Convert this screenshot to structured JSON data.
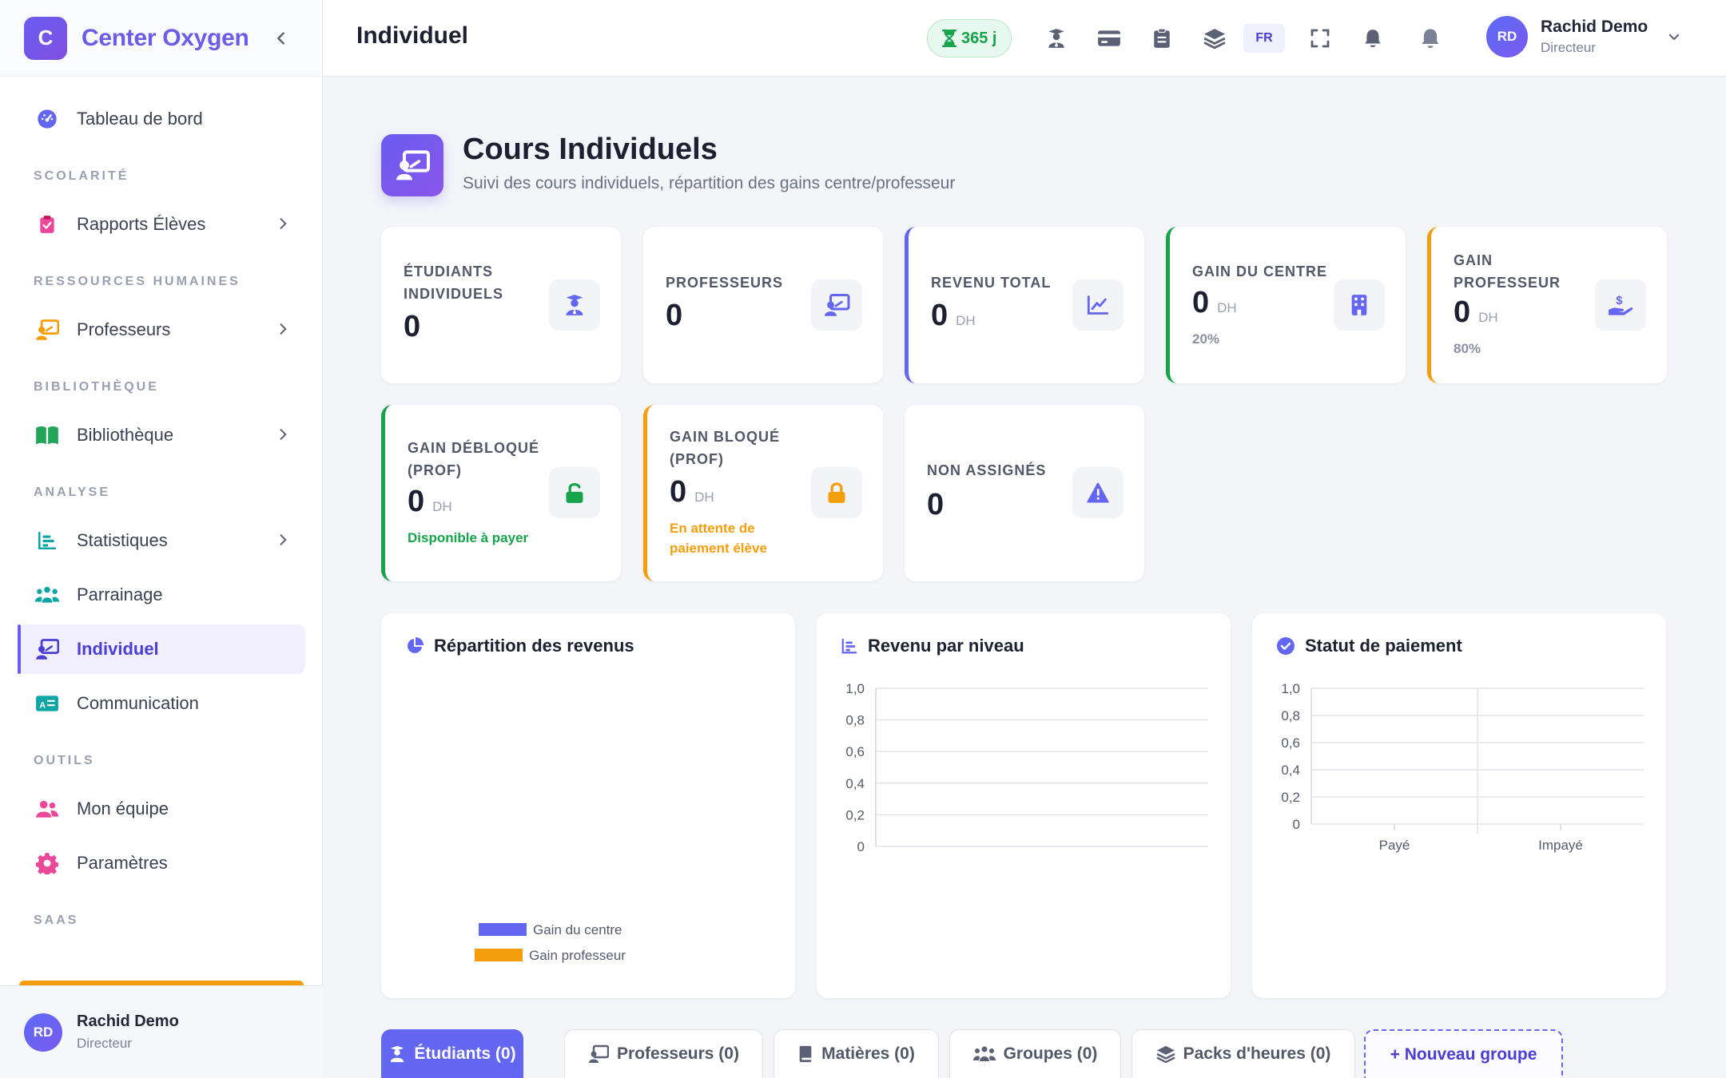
{
  "app": {
    "brand_letter": "C",
    "brand_name": "Center Oxygen"
  },
  "sidebar": {
    "dashboard": "Tableau de bord",
    "sec_scolarite": "SCOLARITÉ",
    "rapports": "Rapports Élèves",
    "sec_rh": "RESSOURCES HUMAINES",
    "professeurs": "Professeurs",
    "sec_biblio": "BIBLIOTHÈQUE",
    "bibliotheque": "Bibliothèque",
    "sec_analyse": "ANALYSE",
    "statistiques": "Statistiques",
    "parrainage": "Parrainage",
    "individuel": "Individuel",
    "communication": "Communication",
    "sec_outils": "OUTILS",
    "equipe": "Mon équipe",
    "parametres": "Paramètres",
    "sec_saas": "SAAS"
  },
  "user": {
    "initials": "RD",
    "name": "Rachid Demo",
    "role": "Directeur"
  },
  "topbar": {
    "title": "Individuel",
    "days": "365 j",
    "lang": "FR"
  },
  "header": {
    "title": "Cours Individuels",
    "subtitle": "Suivi des cours individuels, répartition des gains centre/professeur"
  },
  "stats": {
    "etudiants": {
      "label": "ÉTUDIANTS INDIVIDUELS",
      "value": "0"
    },
    "professeurs": {
      "label": "PROFESSEURS",
      "value": "0"
    },
    "revenu": {
      "label": "REVENU TOTAL",
      "value": "0",
      "unit": "DH"
    },
    "gain_centre": {
      "label": "GAIN DU CENTRE",
      "value": "0",
      "unit": "DH",
      "note": "20%"
    },
    "gain_prof": {
      "label": "GAIN PROFESSEUR",
      "value": "0",
      "unit": "DH",
      "note": "80%"
    },
    "debloque": {
      "label": "GAIN DÉBLOQUÉ (PROF)",
      "value": "0",
      "unit": "DH",
      "note": "Disponible à payer"
    },
    "bloque": {
      "label": "GAIN BLOQUÉ (PROF)",
      "value": "0",
      "unit": "DH",
      "note": "En attente de paiement élève"
    },
    "non_assignes": {
      "label": "NON ASSIGNÉS",
      "value": "0"
    }
  },
  "charts": {
    "repartition_title": "Répartition des revenus",
    "niveau_title": "Revenu par niveau",
    "statut_title": "Statut de paiement"
  },
  "colors": {
    "accent": "#6366f1",
    "success": "#16a34a",
    "warning": "#f59e0b"
  },
  "chart_data": [
    {
      "type": "pie",
      "title": "Répartition des revenus",
      "categories": [
        "Gain du centre",
        "Gain professeur"
      ],
      "values": [
        0,
        0
      ],
      "colors": [
        "#6366f1",
        "#f59e0b"
      ],
      "legend": "bottom"
    },
    {
      "type": "bar",
      "title": "Revenu par niveau",
      "categories": [],
      "values": [],
      "yticks": [
        "1,0",
        "0,8",
        "0,6",
        "0,4",
        "0,2",
        "0"
      ],
      "ylim": [
        0,
        1
      ],
      "grid": true
    },
    {
      "type": "bar",
      "title": "Statut de paiement",
      "categories": [
        "Payé",
        "Impayé"
      ],
      "values": [
        0,
        0
      ],
      "yticks": [
        "1,0",
        "0,8",
        "0,6",
        "0,4",
        "0,2",
        "0"
      ],
      "ylim": [
        0,
        1
      ],
      "grid": true
    }
  ],
  "tabs": [
    {
      "label": "Étudiants (0)"
    },
    {
      "label": "Professeurs (0)"
    },
    {
      "label": "Matières (0)"
    },
    {
      "label": "Groupes (0)"
    },
    {
      "label": "Packs d'heures (0)"
    },
    {
      "label": "+ Nouveau groupe"
    }
  ]
}
